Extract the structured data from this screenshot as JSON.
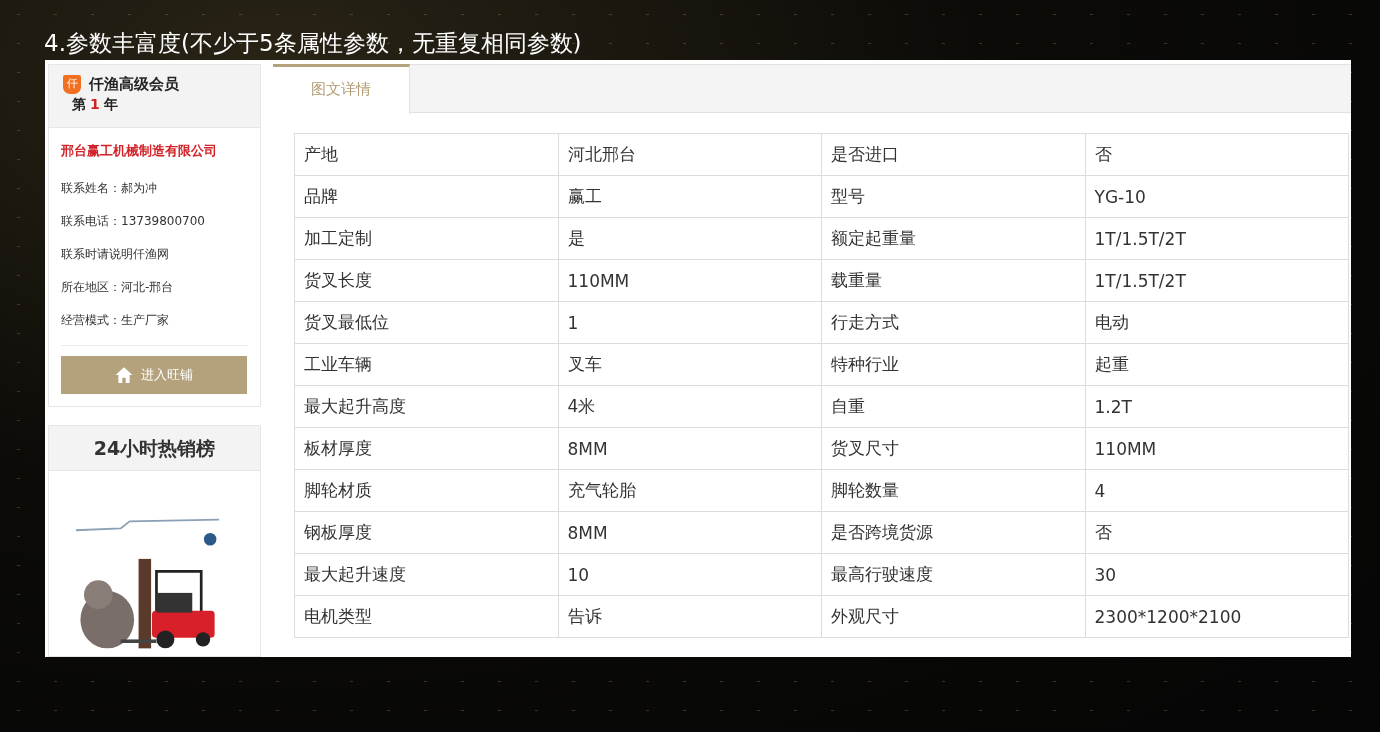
{
  "heading": "4.参数丰富度(不少于5条属性参数，无重复相同参数)",
  "member": {
    "level": "仟渔高级会员",
    "badge": "仟",
    "years_prefix": "第",
    "years": "1",
    "years_suffix": "年"
  },
  "company": "邢台赢工机械制造有限公司",
  "contact_lines": [
    "联系姓名：郝为冲",
    "联系电话：13739800700",
    "联系时请说明仟渔网",
    "所在地区：河北-邢台",
    "经营模式：生产厂家"
  ],
  "shop_button": "进入旺铺",
  "hot_list": {
    "title": "24小时热销榜"
  },
  "tabs": [
    {
      "label": "图文详情",
      "selected": true
    }
  ],
  "table": {
    "rows": [
      [
        "产地",
        "河北邢台",
        "是否进口",
        "否"
      ],
      [
        "品牌",
        "赢工",
        "型号",
        "YG-10"
      ],
      [
        "加工定制",
        "是",
        "额定起重量",
        "1T/1.5T/2T"
      ],
      [
        "货叉长度",
        "110MM",
        "载重量",
        "1T/1.5T/2T"
      ],
      [
        "货叉最低位",
        "1",
        "行走方式",
        "电动"
      ],
      [
        "工业车辆",
        "叉车",
        "特种行业",
        "起重"
      ],
      [
        "最大起升高度",
        "4米",
        "自重",
        "1.2T"
      ],
      [
        "板材厚度",
        "8MM",
        "货叉尺寸",
        "110MM"
      ],
      [
        "脚轮材质",
        "充气轮胎",
        "脚轮数量",
        "4"
      ],
      [
        "钢板厚度",
        "8MM",
        "是否跨境货源",
        "否"
      ],
      [
        "最大起升速度",
        "10",
        "最高行驶速度",
        "30"
      ],
      [
        "电机类型",
        "告诉",
        "外观尺寸",
        "2300*1200*2100"
      ]
    ]
  }
}
